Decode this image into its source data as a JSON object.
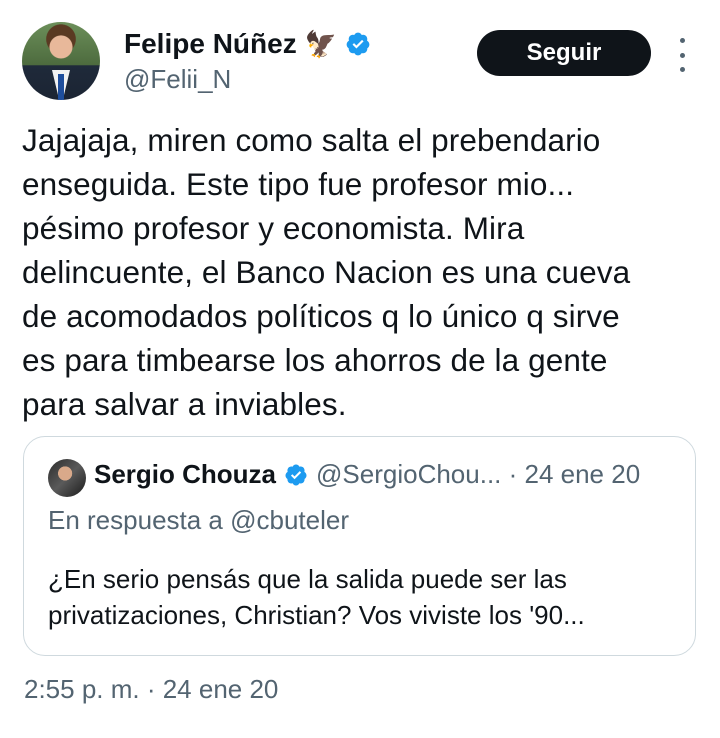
{
  "author": {
    "name": "Felipe Núñez",
    "emoji": "🦅",
    "handle": "@Felii_N"
  },
  "follow_label": "Seguir",
  "tweet_text": "Jajajaja, miren como salta el prebendario\nenseguida. Este tipo fue profesor mio...\npésimo profesor y economista. Mira\ndelincuente, el Banco Nacion es una cueva\nde acomodados políticos q lo único q sirve\nes para timbearse los ahorros de la gente\npara salvar a inviables.",
  "quoted": {
    "name": "Sergio Chouza",
    "handle_date": "@SergioChou... · 24 ene 20",
    "reply_to": "En respuesta a @cbuteler",
    "text": "¿En serio pensás que la salida puede ser las privatizaciones, Christian? Vos viviste los '90..."
  },
  "timestamp": "2:55 p. m. · 24 ene 20",
  "colors": {
    "verified": "#1d9bf0",
    "secondary_text": "#536471",
    "button_bg": "#0f1419"
  },
  "icons": [
    "verified-badge-icon",
    "more-options-icon",
    "eagle-emoji"
  ]
}
